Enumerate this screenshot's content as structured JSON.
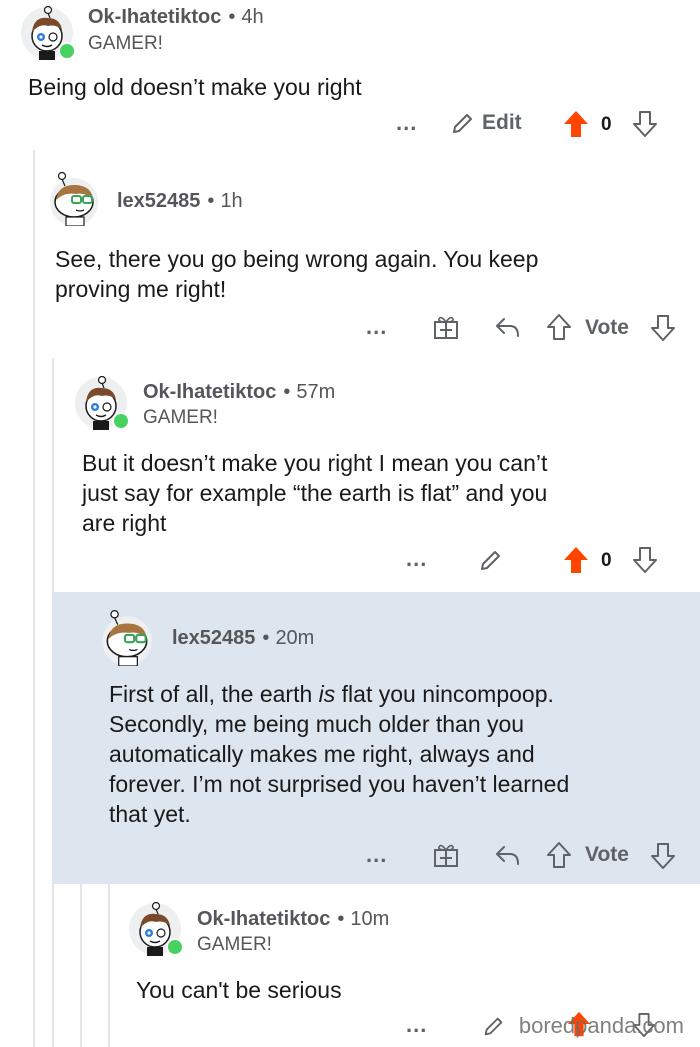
{
  "comments": [
    {
      "username": "Ok-Ihatetiktoc",
      "time": "4h",
      "flair": "GAMER!",
      "body": "Being old doesn’t make you right",
      "edit_label": "Edit",
      "score": "0",
      "avatar_style": "snoo-boy",
      "vote_state": "upvoted"
    },
    {
      "username": "lex52485",
      "time": "1h",
      "body_lines": [
        "See, there you go being wrong again. You keep",
        "proving me right!"
      ],
      "vote_label": "Vote",
      "avatar_style": "snoo-glasses",
      "vote_state": "none"
    },
    {
      "username": "Ok-Ihatetiktoc",
      "time": "57m",
      "flair": "GAMER!",
      "body_lines": [
        "But it doesn’t make you right I mean you can’t",
        "just say for example “the earth is flat” and you",
        "are right"
      ],
      "score": "0",
      "avatar_style": "snoo-boy",
      "vote_state": "upvoted"
    },
    {
      "username": "lex52485",
      "time": "20m",
      "body_line1_a": "First of all, the earth ",
      "body_line1_em": "is",
      "body_line1_b": " flat you nincompoop.",
      "body_lines": [
        "Secondly, me being much older than you",
        "automatically makes me right, always and",
        "forever. I’m not surprised you haven’t learned",
        "that yet."
      ],
      "vote_label": "Vote",
      "avatar_style": "snoo-glasses",
      "vote_state": "none",
      "highlighted": true
    },
    {
      "username": "Ok-Ihatetiktoc",
      "time": "10m",
      "flair": "GAMER!",
      "body": "You can't be serious",
      "avatar_style": "snoo-boy",
      "vote_state": "upvoted"
    }
  ],
  "dots_label": "...",
  "separator": "•",
  "watermark": "boredpanda.com",
  "colors": {
    "upvote": "#ff4500",
    "highlight": "#dde5ee",
    "meta_text": "#555659",
    "online": "#46d160"
  }
}
